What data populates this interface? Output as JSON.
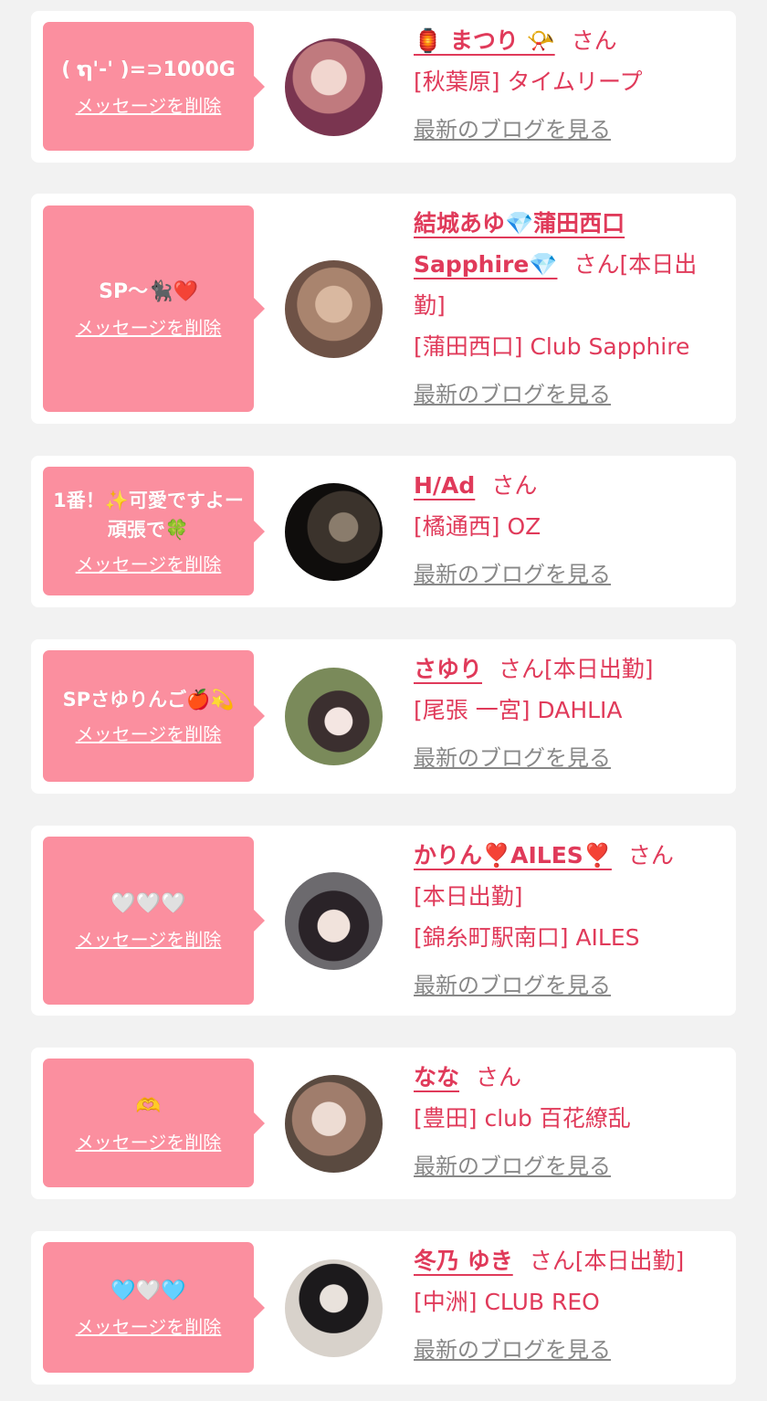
{
  "delete_label": "メッセージを削除",
  "blog_label": "最新のブログを見る",
  "san_label": "さん",
  "items": [
    {
      "message": "( ຖ'-' )=⊃1000G",
      "name": "🏮 まつり 📯",
      "status": "",
      "shop": "[秋葉原] タイムリープ"
    },
    {
      "message": "SP〜🐈‍⬛❤️",
      "name": "結城あゆ💎蒲田西口Sapphire💎",
      "status": "[本日出勤]",
      "shop": "[蒲田西口] Club Sapphire"
    },
    {
      "message": "1番！✨可愛ですよー頑張で🍀",
      "name": "H/Ad",
      "status": "",
      "shop": "[橘通西] OZ"
    },
    {
      "message": "SPさゆりんご🍎💫",
      "name": "さゆり",
      "status": "[本日出勤]",
      "shop": "[尾張 一宮] DAHLIA"
    },
    {
      "message": "🤍🤍🤍",
      "name": "かりん❣️AILES❣️",
      "status": "[本日出勤]",
      "shop": "[錦糸町駅南口] AILES"
    },
    {
      "message": "🫶",
      "name": "なな",
      "status": "",
      "shop": "[豊田] club 百花繚乱"
    },
    {
      "message": "🩵🤍🩵",
      "name": "冬乃 ゆき",
      "status": "[本日出勤]",
      "shop": "[中洲] CLUB REO"
    }
  ],
  "colors": {
    "bubble": "#fb8f9f",
    "accent": "#e03a5a",
    "blog_link": "#888888",
    "background": "#f2f2f2"
  }
}
